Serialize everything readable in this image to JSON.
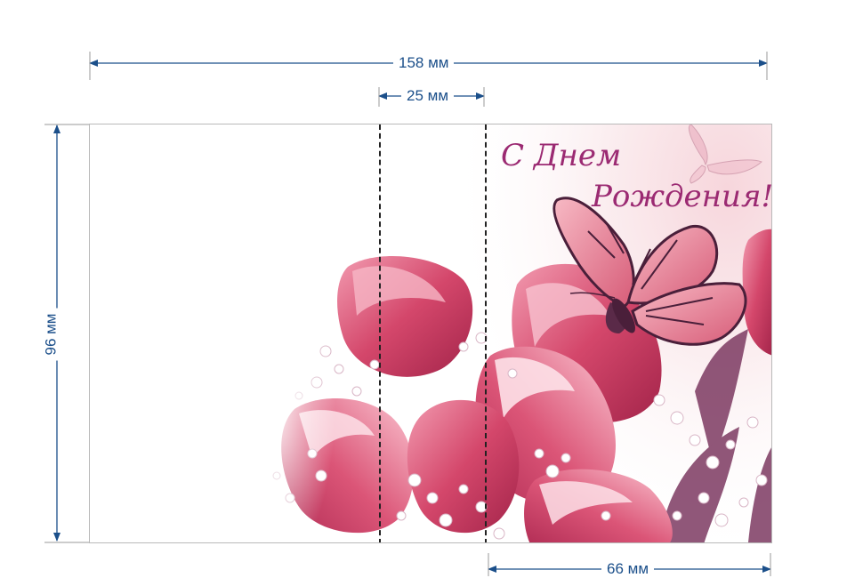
{
  "dimensions": {
    "width_label": "158 мм",
    "flap_label": "25 мм",
    "front_label": "66 мм",
    "height_label": "96 мм"
  },
  "card": {
    "greeting_line1": "С Днем",
    "greeting_line2": "Рождения!",
    "illustration": [
      "tulip",
      "butterfly",
      "gypsophila"
    ]
  },
  "colors": {
    "dimension": "#1b4f8a",
    "greeting": "#9b2a72",
    "tulip": "#d4476b",
    "butterfly": "#c8506c"
  }
}
